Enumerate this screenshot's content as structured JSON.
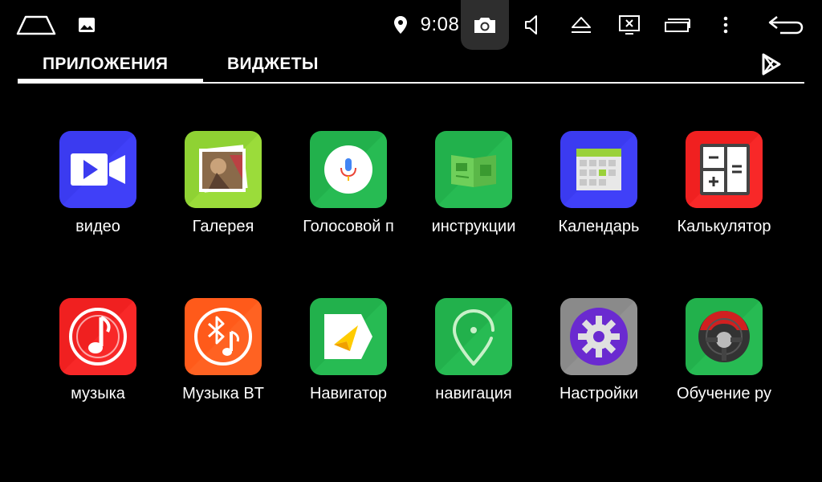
{
  "statusbar": {
    "time": "9:08",
    "icons": [
      "home-outline-icon",
      "image-icon",
      "location-pin-icon",
      "camera-icon",
      "volume-icon",
      "eject-icon",
      "close-screen-icon",
      "recent-apps-icon",
      "more-vertical-icon",
      "back-icon"
    ]
  },
  "tabs": {
    "apps": "ПРИЛОЖЕНИЯ",
    "widgets": "ВИДЖЕТЫ"
  },
  "apps": [
    {
      "label": "видео",
      "icon": "video-icon"
    },
    {
      "label": "Галерея",
      "icon": "gallery-icon"
    },
    {
      "label": "Голосовой п",
      "icon": "voice-search-icon"
    },
    {
      "label": "инструкции",
      "icon": "instructions-book-icon"
    },
    {
      "label": "Календарь",
      "icon": "calendar-icon"
    },
    {
      "label": "Калькулятор",
      "icon": "calculator-icon"
    },
    {
      "label": "музыка",
      "icon": "music-icon"
    },
    {
      "label": "Музыка BT",
      "icon": "bluetooth-music-icon"
    },
    {
      "label": "Навигатор",
      "icon": "navigator-icon"
    },
    {
      "label": "навигация",
      "icon": "navigation-pin-icon"
    },
    {
      "label": "Настройки",
      "icon": "settings-gear-icon"
    },
    {
      "label": "Обучение ру",
      "icon": "steering-wheel-icon"
    }
  ],
  "colors": {
    "background": "#000000",
    "video": "#3b3bf0",
    "gallery": "#8fd233",
    "green": "#22b14c",
    "calendar": "#3b3bf0",
    "red": "#f02020",
    "orange": "#ff5a1a",
    "settings_bg": "#8a8a8a",
    "settings_fg": "#6a2ad0"
  }
}
